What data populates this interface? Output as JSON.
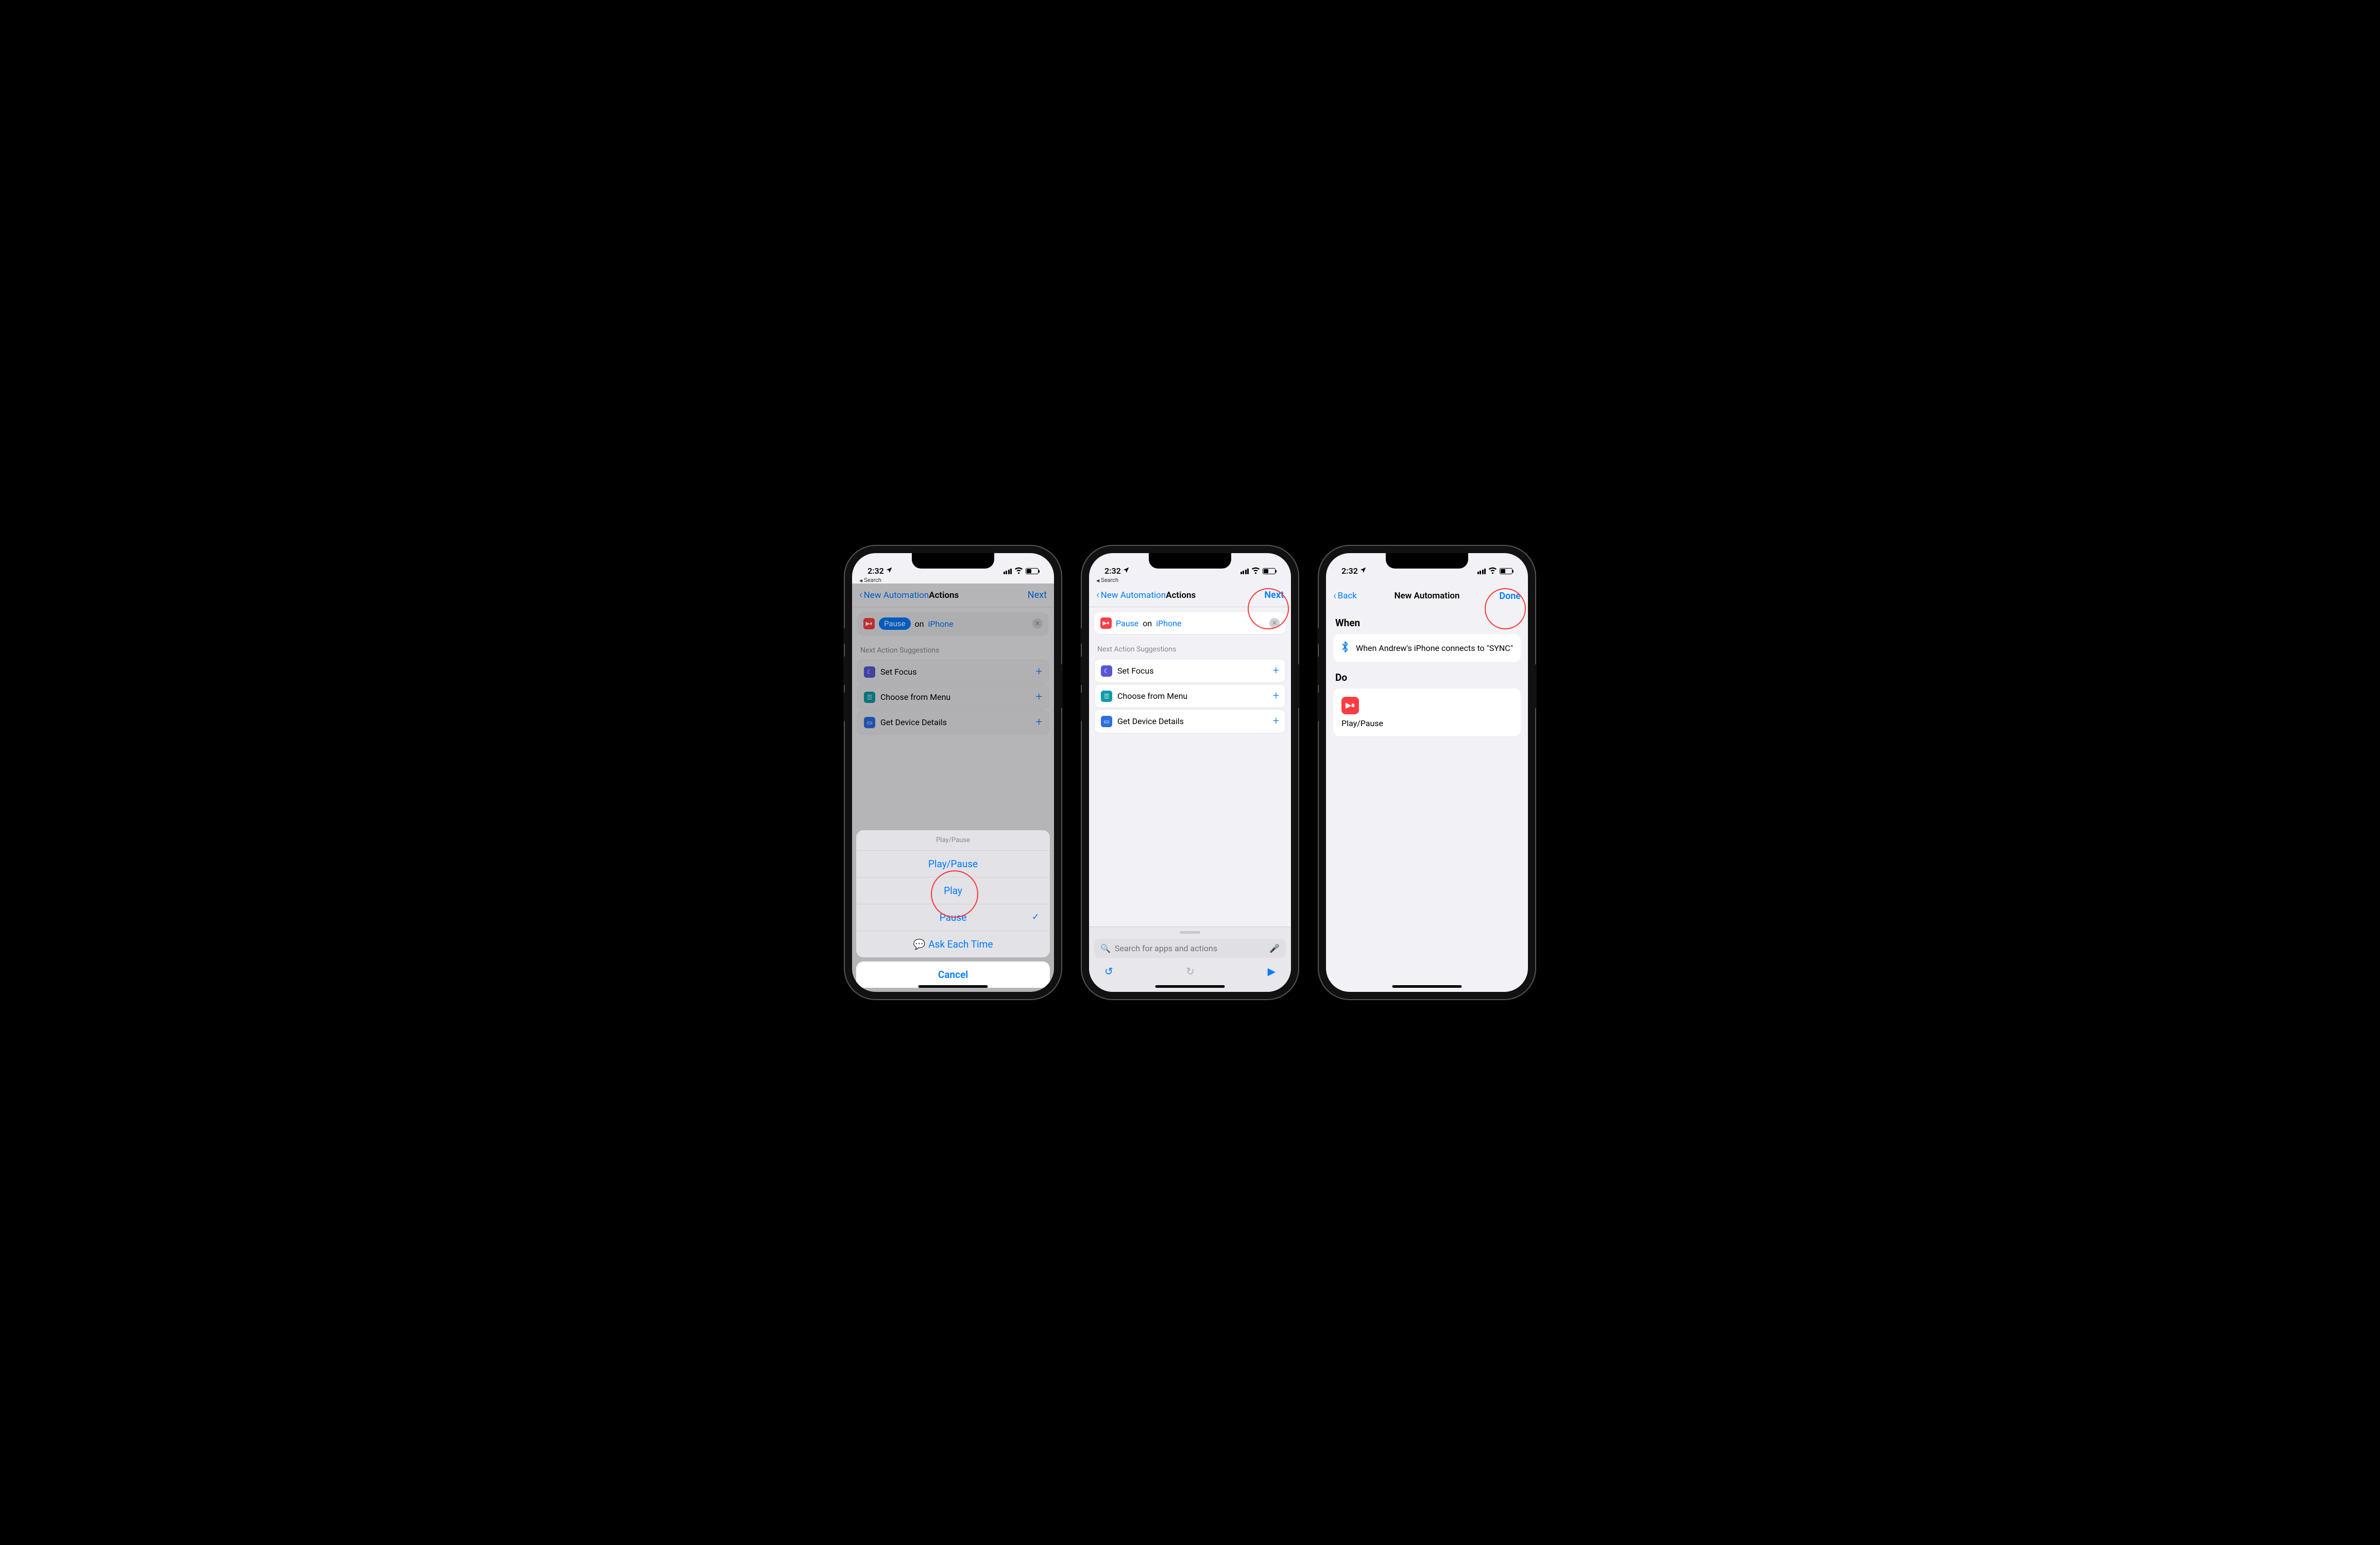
{
  "status": {
    "time": "2:32",
    "back_app": "Search"
  },
  "screen1": {
    "nav": {
      "back": "New Automation",
      "title": "Actions",
      "next": "Next"
    },
    "card": {
      "state": "Pause",
      "on": "on",
      "device": "iPhone"
    },
    "suggestions_header": "Next Action Suggestions",
    "suggestions": [
      {
        "label": "Set Focus"
      },
      {
        "label": "Choose from Menu"
      },
      {
        "label": "Get Device Details"
      }
    ],
    "sheet": {
      "title": "Play/Pause",
      "opts": [
        "Play/Pause",
        "Play",
        "Pause",
        "Ask Each Time"
      ],
      "selected_index": 2,
      "cancel": "Cancel"
    }
  },
  "screen2": {
    "nav": {
      "back": "New Automation",
      "title": "Actions",
      "next": "Next"
    },
    "card": {
      "state": "Pause",
      "on": "on",
      "device": "iPhone"
    },
    "suggestions_header": "Next Action Suggestions",
    "suggestions": [
      {
        "label": "Set Focus"
      },
      {
        "label": "Choose from Menu"
      },
      {
        "label": "Get Device Details"
      }
    ],
    "search_placeholder": "Search for apps and actions"
  },
  "screen3": {
    "nav": {
      "back": "Back",
      "title": "New Automation",
      "done": "Done"
    },
    "when_header": "When",
    "when_text": "When Andrew's iPhone connects to \"SYNC\"",
    "do_header": "Do",
    "do_label": "Play/Pause"
  }
}
